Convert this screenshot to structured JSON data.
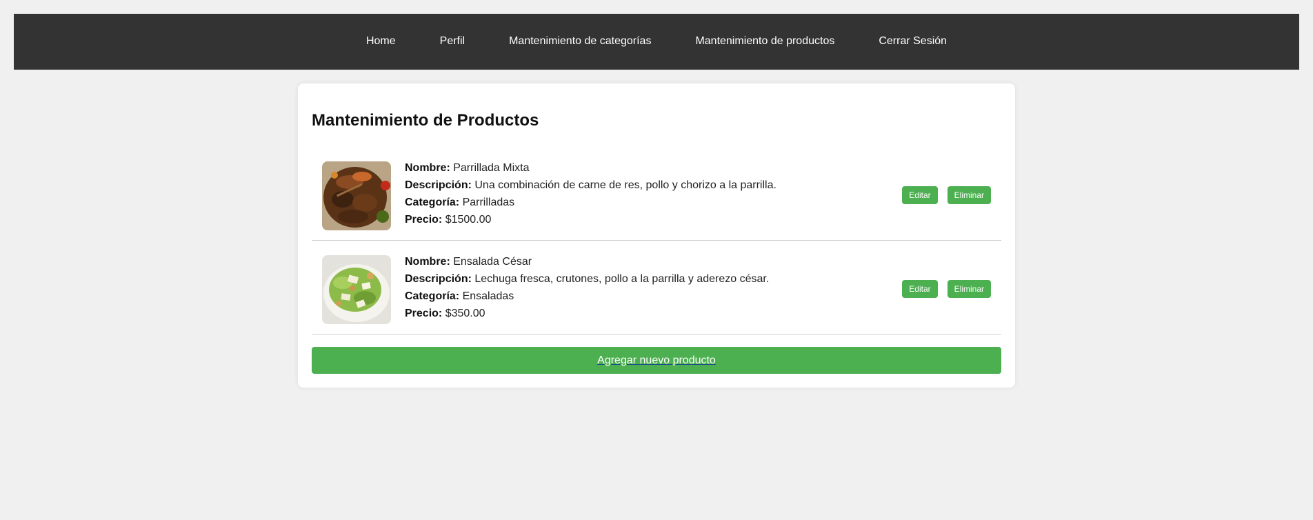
{
  "nav": {
    "items": [
      {
        "label": "Home"
      },
      {
        "label": "Perfil"
      },
      {
        "label": "Mantenimiento de categorías"
      },
      {
        "label": "Mantenimiento de productos"
      },
      {
        "label": "Cerrar Sesión"
      }
    ]
  },
  "page": {
    "title": "Mantenimiento de Productos",
    "add_label": "Agregar nuevo producto"
  },
  "field_labels": {
    "name": "Nombre:",
    "description": "Descripción:",
    "category": "Categoría:",
    "price": "Precio:"
  },
  "buttons": {
    "edit": "Editar",
    "delete": "Eliminar"
  },
  "products": [
    {
      "name": "Parrillada Mixta",
      "description": "Una combinación de carne de res, pollo y chorizo a la parrilla.",
      "category": "Parrilladas",
      "price": "$1500.00",
      "image_icon": "grilled-meat-image"
    },
    {
      "name": "Ensalada César",
      "description": "Lechuga fresca, crutones, pollo a la parrilla y aderezo césar.",
      "category": "Ensaladas",
      "price": "$350.00",
      "image_icon": "caesar-salad-image"
    }
  ],
  "colors": {
    "nav_bg": "#333333",
    "accent": "#4caf50",
    "page_bg": "#f0f0f0"
  }
}
